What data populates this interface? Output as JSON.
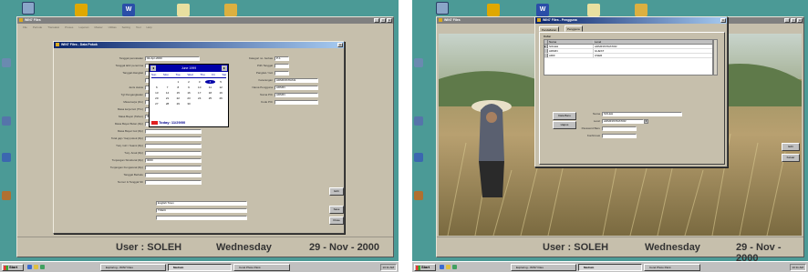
{
  "left": {
    "app_title": "WIN7 Files",
    "menu": [
      "File",
      "Periode",
      "Transaksi",
      "Proses",
      "Laporan",
      "Master",
      "Utilitas",
      "Setting",
      "Tool",
      "Help"
    ],
    "dialog_title": "WIN7 Files - Data Pokok",
    "form_labels": [
      "Tanggal pencatatan",
      "Tanggal lahir penerima",
      "Tanggal diangkat",
      "",
      "Jenis status",
      "Tgl Pengangkatan",
      "Masa kerja (thn)",
      "Masa kerja Gol (Thn)",
      "Masa Bayar (Tahun)",
      "Masa Bayar Bulan (Rp)",
      "Masa Bayar Gol (Rp)",
      "Total gaji / Gaji pokok (Rp)",
      "Tunj. Istri / Suami (Rp)",
      "Tunj. Anak (Rp)",
      "Tunjangan Struktural (Rp)",
      "Tunjangan Fungsional (Rp)",
      "Tanggal Berlaku",
      "Nomor & Tanggal SK"
    ],
    "form_values": [
      "02-Apr-2000",
      "",
      "",
      "",
      "",
      "",
      "",
      "",
      "3000",
      "",
      "",
      "",
      "",
      "",
      "3000",
      "",
      "",
      ""
    ],
    "right_labels": [
      "Kategori no. berkas",
      "Pilih Tanggal",
      "Pangkat / Gol",
      "Keterangan",
      "Nama Pengguna",
      "Nama PIC",
      "Kode PIC"
    ],
    "right_values": [
      "P-1",
      "",
      "",
      "ADMINISTRASI",
      "ADMIN",
      "ADMIN",
      ""
    ],
    "bottom_values": [
      "English Town",
      "TOEIC",
      ""
    ],
    "side_button": "Edit",
    "buttons": [
      "Save",
      "Close"
    ],
    "calendar": {
      "month": "June 1999",
      "dows": [
        "Sun",
        "Mon",
        "Tue",
        "Wed",
        "Thu",
        "Fri",
        "Sat"
      ],
      "days": [
        "",
        "",
        "1",
        "2",
        "3",
        "4",
        "5",
        "6",
        "7",
        "8",
        "9",
        "10",
        "11",
        "12",
        "13",
        "14",
        "15",
        "16",
        "17",
        "18",
        "19",
        "20",
        "21",
        "22",
        "23",
        "24",
        "25",
        "26",
        "27",
        "28",
        "29",
        "30"
      ],
      "selected_day": "4",
      "today": "Today: 11/29/00"
    },
    "status": {
      "user": "User : SOLEH",
      "day": "Wednesday",
      "date": "29 - Nov - 2000"
    },
    "taskbar": {
      "start": "Start",
      "tasks": [
        "Exploring - WIN7 Files",
        "Medium",
        "Corel Photo Paint"
      ],
      "clock": "10:11 AM"
    },
    "desktop_icons": [
      "My Computer",
      "",
      "Microsoft Word",
      "My Documents",
      "Network Neighborhood"
    ]
  },
  "right": {
    "app_title": "WIN7 Files",
    "dialog_title": "WIN7 Files - Pengguna",
    "tabs": [
      "Pendaftaran",
      "Pengguna"
    ],
    "group_label": "Daftar",
    "table": {
      "headers": [
        "Nama",
        "Level"
      ],
      "rows": [
        [
          "SOLEH",
          "ADMINISTRATOR"
        ],
        [
          "ADMIN",
          "GUEST"
        ],
        [
          "ARIF",
          "USER"
        ]
      ]
    },
    "buttons_left": [
      "Data Baru",
      "Hapus"
    ],
    "field_labels": [
      "Nama",
      "Level",
      "Password Baru",
      "Konfirmasi"
    ],
    "field_values": [
      "SOLEH",
      "ADMINISTRATOR",
      "",
      ""
    ],
    "side_buttons": [
      "Edit",
      "Keluar"
    ],
    "status": {
      "user": "User : SOLEH",
      "day": "Wednesday",
      "date": "29 - Nov - 2000"
    },
    "taskbar": {
      "start": "Start",
      "tasks": [
        "Exploring - WIN7 Files",
        "Medium",
        "Corel Photo Paint"
      ],
      "clock": "10:11 AM"
    }
  }
}
